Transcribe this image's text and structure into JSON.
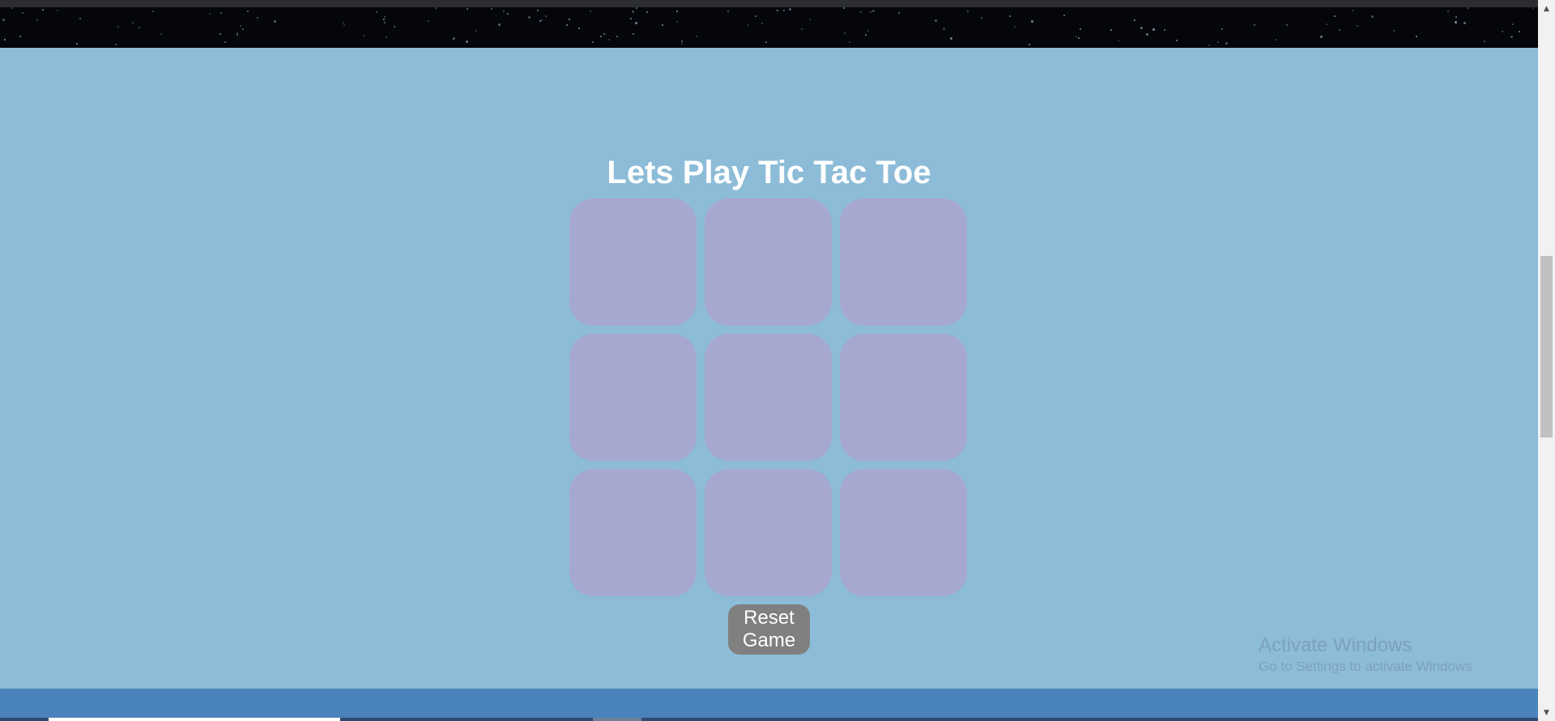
{
  "game": {
    "title": "Lets Play Tic Tac Toe",
    "board": [
      [
        "",
        "",
        ""
      ],
      [
        "",
        "",
        ""
      ],
      [
        "",
        "",
        ""
      ]
    ],
    "reset_label": "Reset Game"
  },
  "watermark": {
    "title": "Activate Windows",
    "subtitle": "Go to Settings to activate Windows"
  },
  "icons": {
    "scroll_up": "scroll-up-arrow-icon",
    "scroll_down": "scroll-down-arrow-icon"
  },
  "colors": {
    "page_background": "#8dbcd8",
    "cell": "#a6a8cf",
    "reset_button": "#808080",
    "footer": "#4a83bb",
    "starfield": "#04060b"
  }
}
